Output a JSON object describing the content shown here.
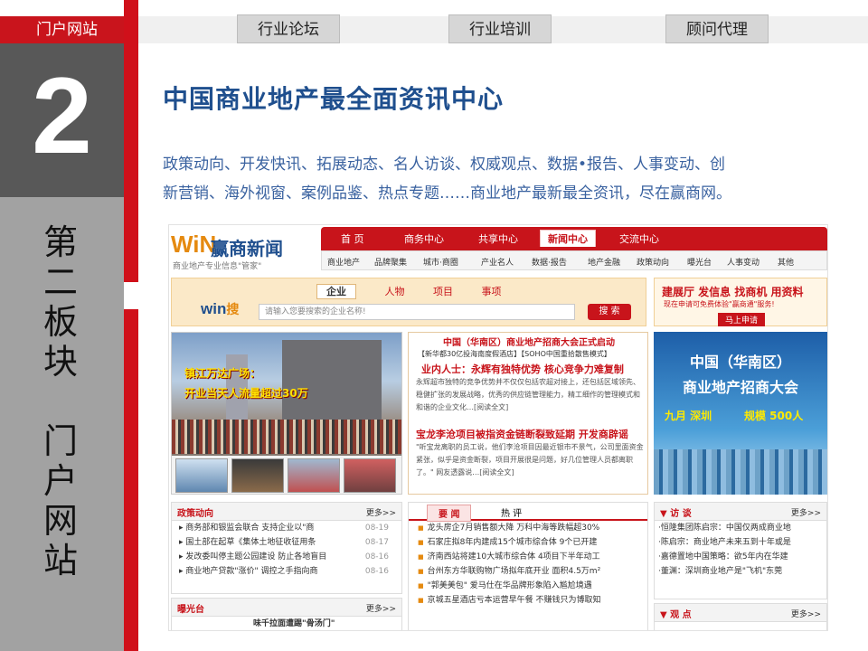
{
  "topnav": {
    "portal": "门户网站",
    "tabs": [
      "行业论坛",
      "行业培训",
      "顾问代理"
    ]
  },
  "section": {
    "number": "2",
    "vertical_title": [
      "第",
      "二",
      "板",
      "块",
      "",
      "门",
      "户",
      "网",
      "站"
    ]
  },
  "main": {
    "heading": "中国商业地产最全面资讯中心",
    "description_line1": "政策动向、开发快讯、拓展动态、名人访谈、权威观点、数据•报告、人事变动、创",
    "description_line2": "新营销、海外视窗、案例品鉴、热点专题……商业地产最新最全资讯，尽在赢商网。"
  },
  "site": {
    "logo_mark": "WiN",
    "logo_name": "赢商新闻",
    "logo_sub": "商业地产专业信息\"管家\"",
    "nav_main": [
      "首 页",
      "商务中心",
      "共享中心",
      "新闻中心",
      "交流中心"
    ],
    "nav_sub": [
      "商业地产",
      "品牌聚集",
      "城市·商圈",
      "产业名人",
      "数据·报告",
      "地产金融",
      "政策动向",
      "曝光台",
      "人事变动",
      "其他"
    ],
    "search": {
      "tabs": [
        "企业",
        "人物",
        "项目",
        "事项"
      ],
      "brand": "win",
      "brand_suffix": "搜",
      "placeholder": "请输入您要搜索的企业名称!",
      "button": "搜 索"
    },
    "ad": {
      "line1": "建展厅 发信息 找商机 用资料",
      "line2": "现在申请可免费体验\"赢商通\"服务!",
      "button": "马上申请"
    },
    "photo": {
      "caption1": "镇江万达广场：",
      "caption2": "开业当天人流量超过30万"
    },
    "news": {
      "headline": "中国（华南区）商业地产招商大会正式启动",
      "sources": "【新华都30亿投海南度假酒店】【SOHO中国重拾散售模式】",
      "title2": "业内人士：永辉有独特优势 核心竞争力难复制",
      "para1": "永辉超市独特的竞争优势并不仅仅包括农超对接上，还包括区域领先、稳健扩张的发展战略，优秀的供应链管理能力，精工细作的管理模式和和谐的企业文化…[阅读全文]",
      "title3": "宝龙李沧项目被指资金链断裂致延期 开发商辟谣",
      "para2": "\"听宝龙离职的员工说，他们李沧项目因最近银市不景气，公司里面资金紧张，似乎是资金断裂，项目开展很是问题，好几位管理人员都离职了。\" 网友透露说…[阅读全文]"
    },
    "banner": {
      "line1": "中国（华南区）",
      "line2": "商业地产招商大会",
      "date": "九月 深圳",
      "scale": "规模 500人"
    },
    "policy": {
      "title": "政策动向",
      "more": "更多>>",
      "items": [
        {
          "text": "商务部和银监会联合 支持企业以\"商",
          "date": "08-19"
        },
        {
          "text": "国土部在起草《集体土地征收征用条",
          "date": "08-17"
        },
        {
          "text": "发改委叫停主题公园建设 防止各地盲目",
          "date": "08-16"
        },
        {
          "text": "商业地产贷款\"涨价\" 调控之手指向商",
          "date": "08-16"
        }
      ]
    },
    "expose": {
      "title": "曝光台",
      "more": "更多>>",
      "items": [
        "味千拉面遭踢\"骨汤门\""
      ]
    },
    "focus": {
      "tabs": [
        "要 闻",
        "热 评"
      ],
      "items": [
        "龙头房企7月销售额大降 万科中海等跌幅超30%",
        "石家庄拟8年内建成15个城市综合体 9个已开建",
        "济南西站将建10大城市综合体 4项目下半年动工",
        "台州东方华联购物广场拟年底开业 面积4.5万m²",
        "\"郭美美包\" 爱马仕在华品牌形象陷入尴尬境遇",
        "京城五星酒店亏本运营早午餐 不赚钱只为博取知"
      ]
    },
    "interview": {
      "title": "访 谈",
      "more": "更多>>",
      "items": [
        "·恒隆集团陈启宗：中国仅两成商业地",
        "·陈启宗：商业地产未来五到十年或是",
        "·嘉德置地中国策略：欲5年内在华建",
        "·董渊：深圳商业地产是\"飞机\"东莞"
      ]
    },
    "viewpoint": {
      "title": "观 点",
      "more": "更多>>"
    }
  }
}
